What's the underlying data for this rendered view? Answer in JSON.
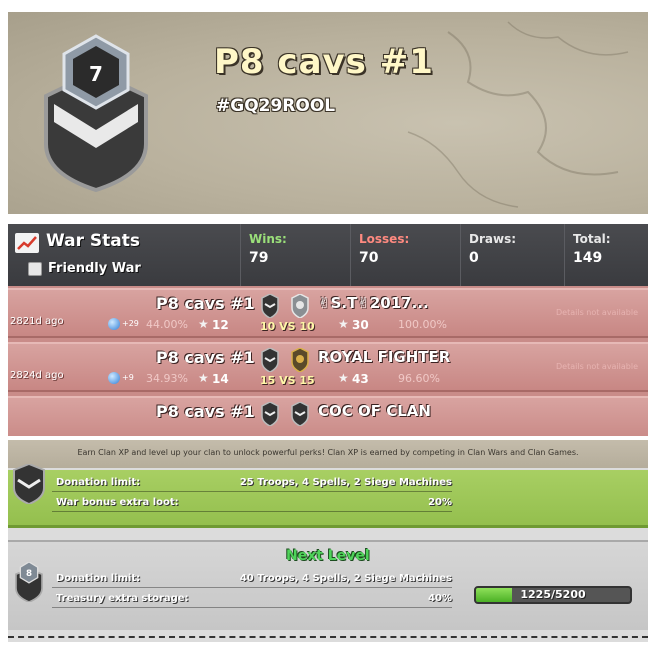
{
  "header": {
    "badge_level": "7",
    "clan_name": "P8 cavs #1",
    "clan_tag": "#GQ29ROOL"
  },
  "war_stats": {
    "title": "War Stats",
    "friendly_war_label": "Friendly War",
    "columns": [
      {
        "label": "Wins:",
        "value": "79",
        "color": "#9be07a"
      },
      {
        "label": "Losses:",
        "value": "70",
        "color": "#ff8a80"
      },
      {
        "label": "Draws:",
        "value": "0",
        "color": "#e8e8e8"
      },
      {
        "label": "Total:",
        "value": "149",
        "color": "#e8e8e8"
      }
    ],
    "rows": [
      {
        "ago": "2821d ago",
        "xp": "+29",
        "my_pct": "44.00%",
        "my_stars": "12",
        "my_name": "P8 cavs #1",
        "score": "10 VS 10",
        "opp_name": "✌S.T✌2017...",
        "opp_stars": "30",
        "opp_pct": "100.00%",
        "details": "Details not available"
      },
      {
        "ago": "2824d ago",
        "xp": "+9",
        "my_pct": "34.93%",
        "my_stars": "14",
        "my_name": "P8 cavs #1",
        "score": "15 VS 15",
        "opp_name": "ROYAL FIGHTER",
        "opp_stars": "43",
        "opp_pct": "96.60%",
        "details": "Details not available"
      },
      {
        "ago": "",
        "xp": "",
        "my_pct": "",
        "my_stars": "",
        "my_name": "P8 cavs #1",
        "score": "",
        "opp_name": "COC OF CLAN",
        "opp_stars": "",
        "opp_pct": "",
        "details": ""
      }
    ]
  },
  "perks": {
    "info_text": "Earn Clan XP and level up your clan to unlock powerful perks! Clan XP is earned by competing in Clan Wars and Clan Games.",
    "current": {
      "rows": [
        {
          "label": "Donation limit:",
          "value": "25 Troops, 4 Spells, 2 Siege Machines"
        },
        {
          "label": "War bonus extra loot:",
          "value": "20%"
        }
      ]
    },
    "next": {
      "title": "Next Level",
      "badge_level": "8",
      "rows": [
        {
          "label": "Donation limit:",
          "value": "40 Troops, 4 Spells, 2 Siege Machines"
        },
        {
          "label": "Treasury extra storage:",
          "value": "40%"
        }
      ],
      "xp_text": "1225/5200",
      "xp_current": 1225,
      "xp_max": 5200
    }
  },
  "colors": {
    "win_row": "#c98c89",
    "perk_green": "#9fc95a",
    "next_level_green": "#4fd35a"
  }
}
